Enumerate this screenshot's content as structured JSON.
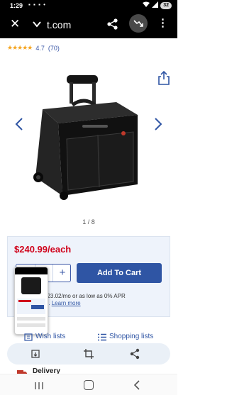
{
  "status_bar": {
    "time": "1:29",
    "battery": "32"
  },
  "browser": {
    "url": "t.com"
  },
  "rating": {
    "value": "4.7",
    "count": "(70)"
  },
  "gallery": {
    "pager": "1 / 8"
  },
  "purchase": {
    "price": "$240.99/each",
    "quantity": "1",
    "minus": "−",
    "plus": "+",
    "add_to_cart": "Add To Cart",
    "finance_text": "$23.02/mo or as low as 0% APR",
    "finance_link_prefix": "al.",
    "learn_more": "Learn more"
  },
  "lists": {
    "wish": "Wish lists",
    "shopping": "Shopping lists"
  },
  "delivery": {
    "label": "Delivery"
  },
  "colors": {
    "accent": "#2f55a4",
    "price": "#d0021b",
    "star": "#f5a623"
  }
}
